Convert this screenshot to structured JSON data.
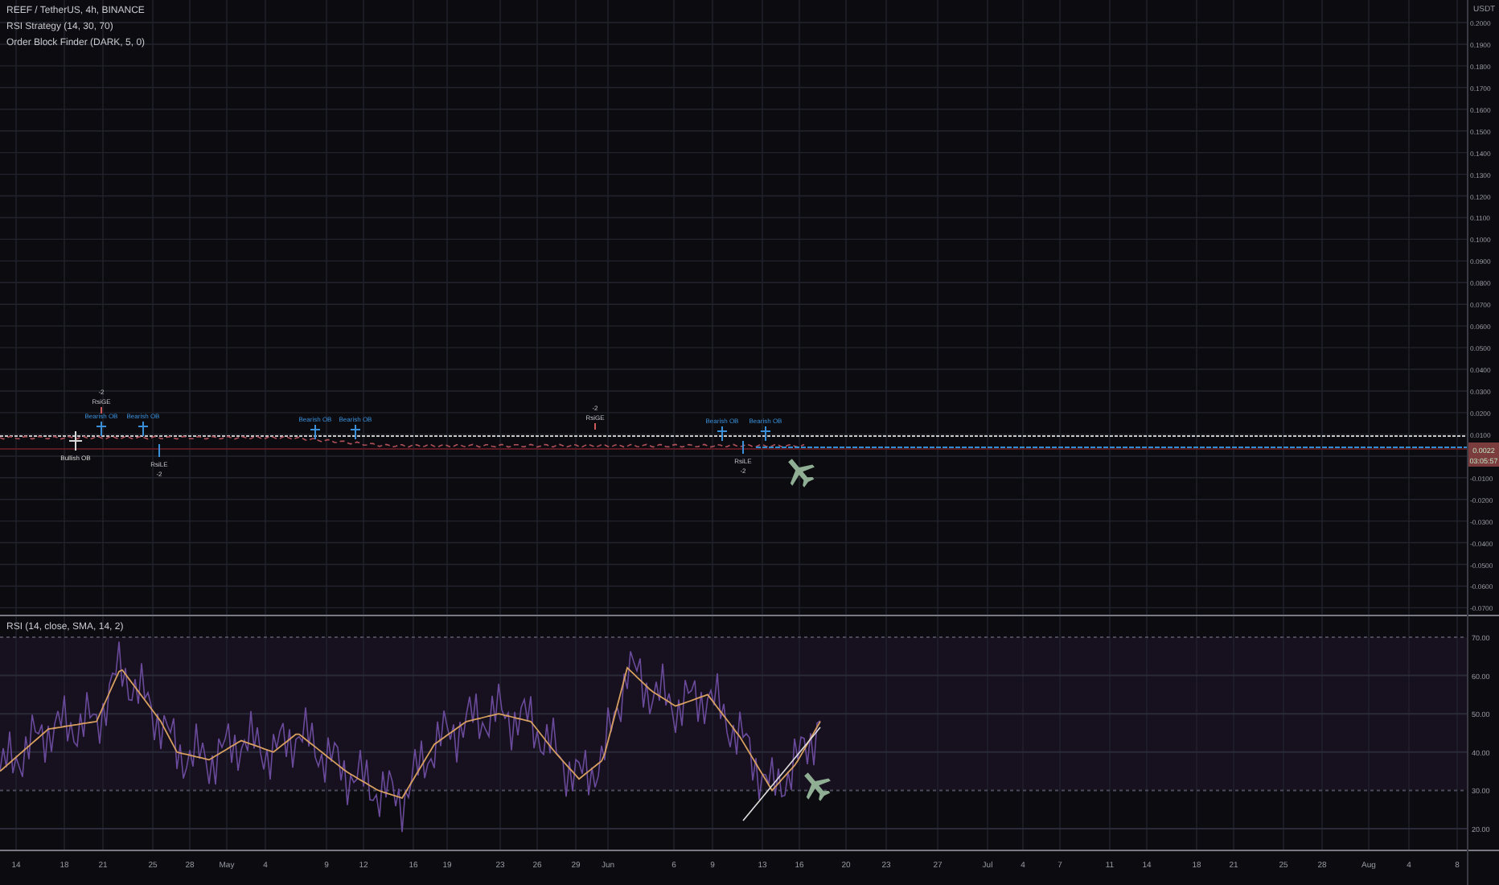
{
  "legend": [
    "REEF / TetherUS, 4h, BINANCE",
    "RSI Strategy (14, 30, 70)",
    "Order Block Finder (DARK, 5, 0)"
  ],
  "price_axis": {
    "unit": "USDT",
    "labels": [
      "0.2000",
      "0.1900",
      "0.1800",
      "0.1700",
      "0.1600",
      "0.1500",
      "0.1400",
      "0.1300",
      "0.1200",
      "0.1100",
      "0.1000",
      "0.0900",
      "0.0800",
      "0.0700",
      "0.0600",
      "0.0500",
      "0.0400",
      "0.0300",
      "0.0200",
      "0.0100",
      "-0.0100",
      "-0.0200",
      "-0.0300",
      "-0.0400",
      "-0.0500",
      "-0.0600",
      "-0.0700"
    ],
    "last_price": "0.0022",
    "countdown": "03:05:57"
  },
  "markers": [
    {
      "kind": "bullish_ob",
      "label": "Bullish OB"
    },
    {
      "kind": "rsi_ge",
      "label": "RsiGE",
      "value": "-2"
    },
    {
      "kind": "bearish_ob",
      "label": "Bearish OB"
    },
    {
      "kind": "bearish_ob",
      "label": "Bearish OB"
    },
    {
      "kind": "rsi_le",
      "label": "RsiLE",
      "value": "-2"
    },
    {
      "kind": "bearish_ob",
      "label": "Bearish OB"
    },
    {
      "kind": "bearish_ob",
      "label": "Bearish OB"
    },
    {
      "kind": "rsi_ge",
      "label": "RsiGE",
      "value": "-2"
    },
    {
      "kind": "bearish_ob",
      "label": "Bearish OB"
    },
    {
      "kind": "rsi_le",
      "label": "RsiLE",
      "value": "-2"
    },
    {
      "kind": "bearish_ob",
      "label": "Bearish OB"
    }
  ],
  "rsi": {
    "title": "RSI (14, close, SMA, 14, 2)",
    "axis": [
      "70.00",
      "60.00",
      "50.00",
      "40.00",
      "30.00",
      "20.00"
    ]
  },
  "time_axis": [
    "14",
    "18",
    "21",
    "25",
    "28",
    "May",
    "4",
    "9",
    "12",
    "16",
    "19",
    "23",
    "26",
    "29",
    "Jun",
    "6",
    "9",
    "13",
    "16",
    "20",
    "23",
    "27",
    "Jul",
    "4",
    "7",
    "11",
    "14",
    "18",
    "21",
    "25",
    "28",
    "Aug",
    "4",
    "8"
  ]
}
